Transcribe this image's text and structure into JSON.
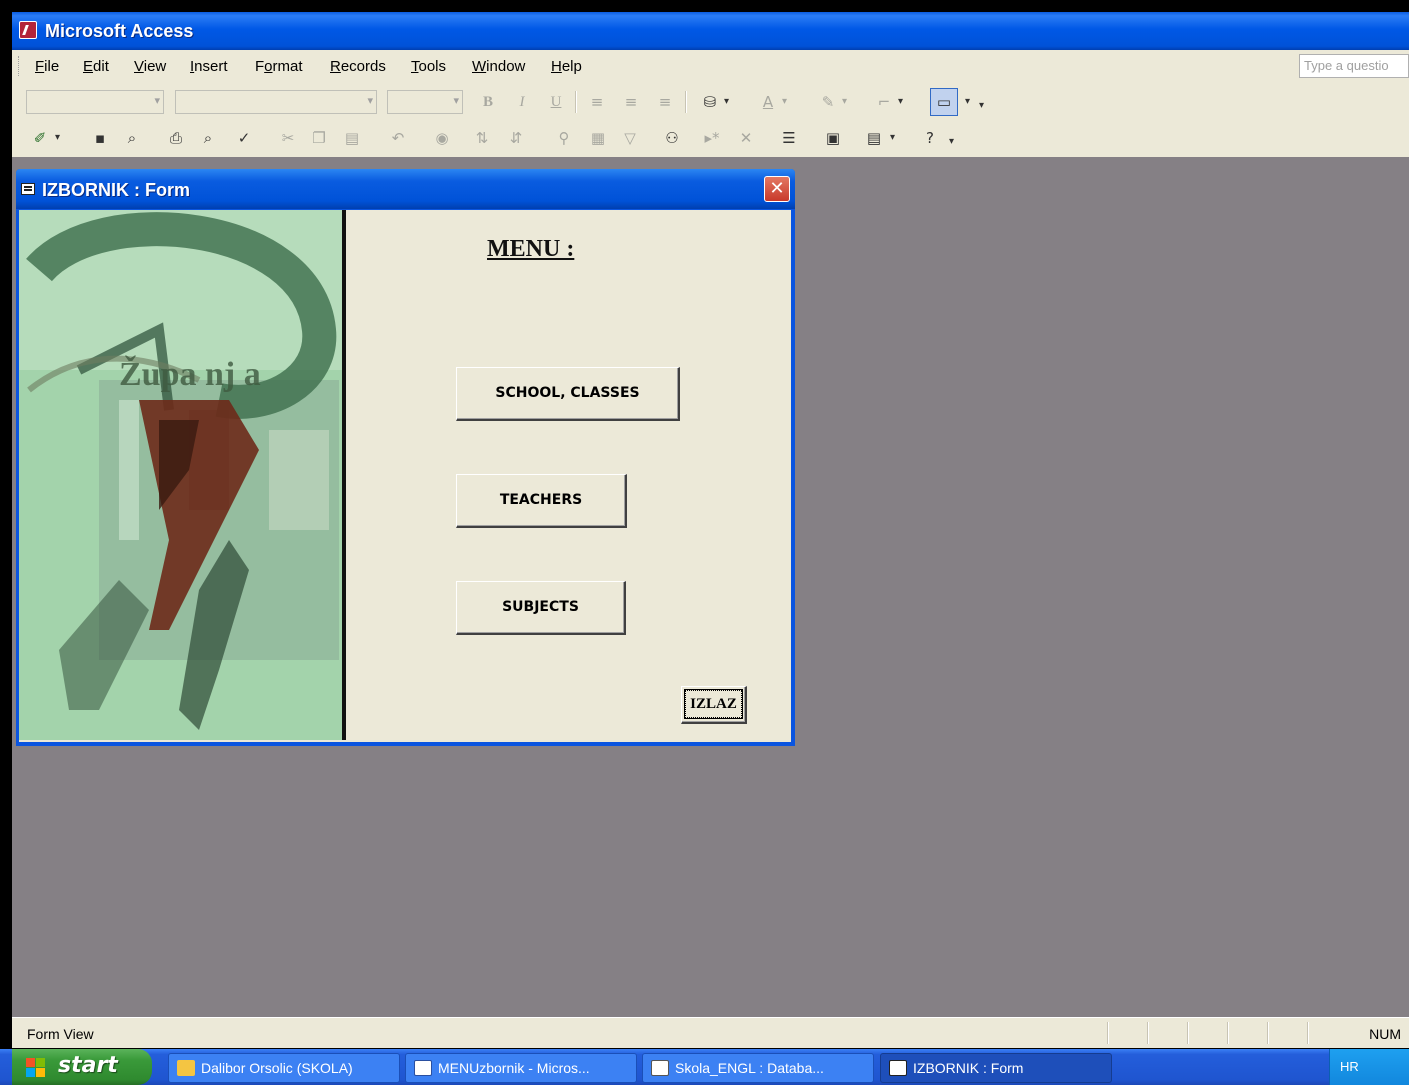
{
  "app": {
    "title": "Microsoft Access"
  },
  "menubar": {
    "items": [
      {
        "label": "File",
        "accel": "F",
        "rest": "ile"
      },
      {
        "label": "Edit",
        "accel": "E",
        "rest": "dit"
      },
      {
        "label": "View",
        "accel": "V",
        "rest": "iew"
      },
      {
        "label": "Insert",
        "accel": "I",
        "rest": "nsert"
      },
      {
        "label": "Format",
        "pre": "F",
        "accel": "o",
        "rest": "rmat"
      },
      {
        "label": "Records",
        "accel": "R",
        "rest": "ecords"
      },
      {
        "label": "Tools",
        "accel": "T",
        "rest": "ools"
      },
      {
        "label": "Window",
        "accel": "W",
        "rest": "indow"
      },
      {
        "label": "Help",
        "accel": "H",
        "rest": "elp"
      }
    ],
    "help_placeholder": "Type a questio"
  },
  "form": {
    "title": "IZBORNIK : Form",
    "heading": "MENU :",
    "buttons": {
      "school": "SCHOOL, CLASSES",
      "teachers": "TEACHERS",
      "subjects": "SUBJECTS",
      "exit": "IZLAZ"
    },
    "picture_text": "Župa nj a"
  },
  "statusbar": {
    "mode": "Form View",
    "num": "NUM"
  },
  "taskbar": {
    "start": "start",
    "tasks": [
      {
        "label": "Dalibor Orsolic (SKOLA)",
        "icon": "folder-icon",
        "active": false
      },
      {
        "label": "MENUzbornik - Micros...",
        "icon": "word-icon",
        "active": false
      },
      {
        "label": "Skola_ENGL : Databa...",
        "icon": "database-icon",
        "active": false
      },
      {
        "label": "IZBORNIK : Form",
        "icon": "form-icon",
        "active": true
      }
    ],
    "tray_lang": "HR"
  },
  "colors": {
    "accent": "#0054e3",
    "workspace": "#858085",
    "face": "#ece9d8"
  }
}
